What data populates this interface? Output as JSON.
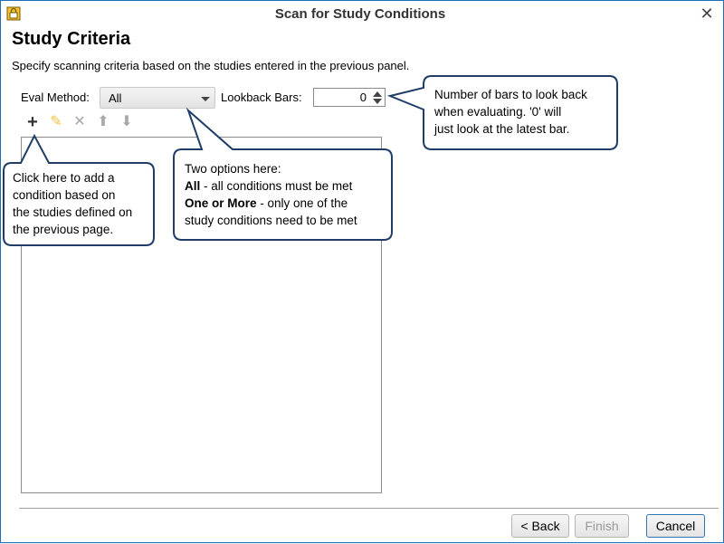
{
  "window": {
    "title": "Scan for Study Conditions",
    "close_glyph": "✕",
    "app_icon": "lock-app-icon"
  },
  "page": {
    "title": "Study Criteria",
    "description": "Specify scanning criteria based on the studies entered in the previous panel."
  },
  "criteria": {
    "eval_method_label": "Eval Method:",
    "eval_method_value": "All",
    "lookback_label": "Lookback Bars:",
    "lookback_value": "0"
  },
  "toolbar": {
    "add_glyph": "+",
    "edit_glyph": "✎",
    "remove_glyph": "✕",
    "up_glyph": "⬆",
    "down_glyph": "⬇"
  },
  "callouts": {
    "lookback": {
      "line1": "Number of bars to look back",
      "line2": "when evaluating.  '0' will",
      "line3": "just look at the latest bar."
    },
    "eval": {
      "line1": "Two options here:",
      "all_bold": "All",
      "all_rest": " - all conditions must be met",
      "more_bold": "One or More",
      "more_rest": " - only one of the",
      "line4": "study conditions need to be met"
    },
    "add": {
      "line1": "Click here to add a",
      "line2": "condition based on",
      "line3": "the studies defined on",
      "line4": "the previous page."
    }
  },
  "buttons": {
    "back": "< Back",
    "finish": "Finish",
    "cancel": "Cancel"
  },
  "colors": {
    "window_border": "#1e6fb8",
    "callout_border": "#1f3d66",
    "edit_icon": "#f0c040",
    "disabled_icon": "#a8a8a8"
  }
}
